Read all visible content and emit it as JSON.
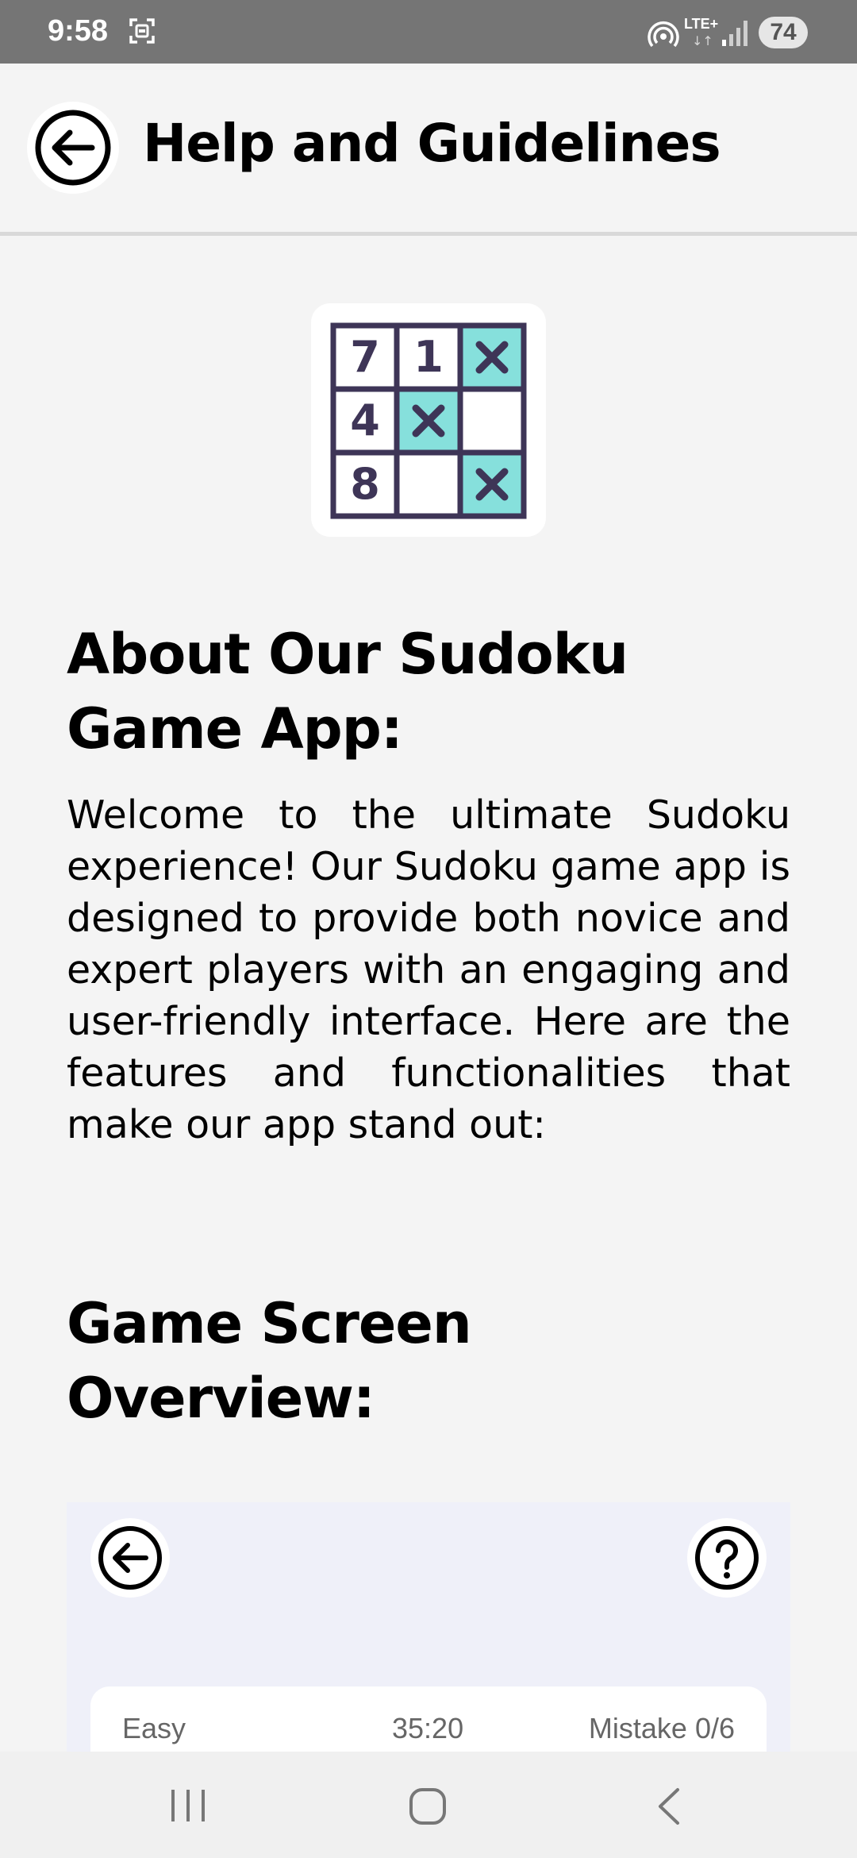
{
  "status_bar": {
    "time": "9:58",
    "network": "LTE+",
    "network_arrows": "↓↑",
    "battery": "74",
    "icons": [
      "screenshot-icon",
      "hotspot-icon",
      "signal-icon"
    ]
  },
  "header": {
    "title": "Help and Guidelines",
    "back_icon": "back-arrow-icon"
  },
  "logo": {
    "icon": "sudoku-grid-logo",
    "digits": [
      "7",
      "1",
      "4",
      "8"
    ],
    "colors": {
      "grid": "#3e3557",
      "highlight": "#86e0dc",
      "cell": "#ffffff"
    }
  },
  "about": {
    "heading": "About Our Sudoku Game App:",
    "body": "Welcome to the ultimate Sudoku experience! Our Sudoku game app is designed to provide both novice and expert players with an engaging and user-friendly interface. Here are the features and functionalities that make our app stand out:"
  },
  "overview": {
    "heading": "Game Screen Overview:"
  },
  "game_preview": {
    "difficulty": "Easy",
    "timer": "35:20",
    "mistakes": "Mistake 0/6",
    "icons": [
      "back-arrow-icon",
      "help-question-icon"
    ]
  },
  "nav_bar": {
    "icons": [
      "recents-icon",
      "home-icon",
      "back-chevron-icon"
    ]
  },
  "colors": {
    "status_bar": "#757575",
    "background": "#f4f4f4",
    "preview_background": "#eff0f9",
    "accent": "#86e0dc"
  }
}
